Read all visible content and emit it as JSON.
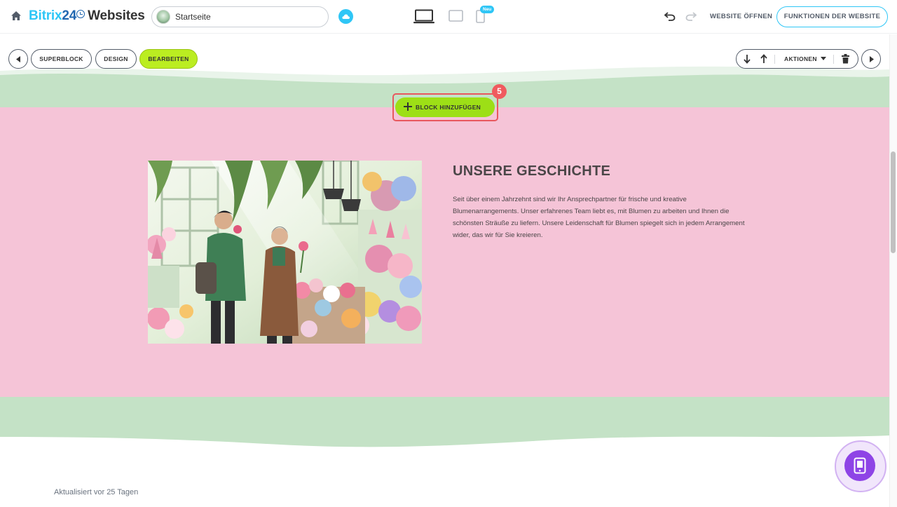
{
  "header": {
    "logo_part1": "Bitrix",
    "logo_part2": "24",
    "logo_part3": "Websites",
    "page_selector_value": "Startseite",
    "new_badge": "Neu",
    "open_website_label": "WEBSITE ÖFFNEN",
    "website_functions_label": "FUNKTIONEN DER WEBSITE"
  },
  "editor_toolbar": {
    "superblock_label": "SUPERBLOCK",
    "design_label": "DESIGN",
    "edit_label": "BEARBEITEN",
    "actions_label": "AKTIONEN"
  },
  "add_block": {
    "label": "BLOCK HINZUFÜGEN",
    "step_badge": "5"
  },
  "section": {
    "title": "UNSERE GESCHICHTE",
    "text": "Seit über einem Jahrzehnt sind wir Ihr Ansprechpartner für frische und kreative Blumenarrangements. Unser erfahrenes Team liebt es, mit Blumen zu arbeiten und Ihnen die schönsten Sträuße zu liefern. Unsere Leidenschaft für Blumen spiegelt sich in jedem Arrangement wider, das wir für Sie kreieren."
  },
  "footer": {
    "updated_text": "Aktualisiert vor 25 Tagen"
  },
  "colors": {
    "brand_cyan": "#2fc6f6",
    "brand_blue": "#2067b0",
    "active_green": "#bbed21",
    "section_pink": "#f5c4d7",
    "wave_green": "#c4e2c6",
    "highlight_red": "#e8585e",
    "fab_purple": "#8e44e6"
  },
  "icons": [
    "home-icon",
    "cloud-icon",
    "desktop-icon",
    "tablet-icon",
    "mobile-icon",
    "undo-icon",
    "redo-icon",
    "arrow-down-icon",
    "arrow-up-icon",
    "caret-down-icon",
    "trash-icon",
    "chevron-left-icon",
    "chevron-right-icon",
    "plus-icon",
    "mobile-preview-icon"
  ]
}
